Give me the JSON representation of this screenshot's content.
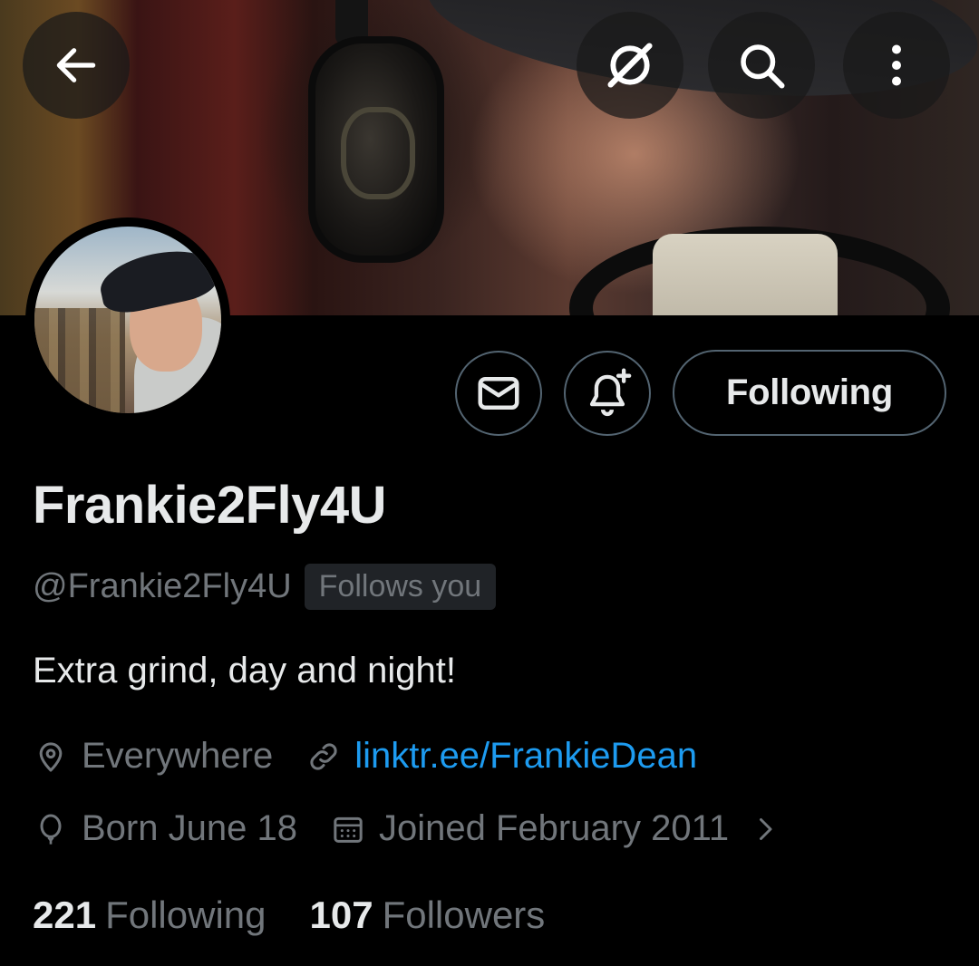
{
  "header": {
    "back_icon": "arrow-left-icon",
    "grok_icon": "grok-icon",
    "search_icon": "search-icon",
    "more_icon": "more-vertical-icon"
  },
  "profile": {
    "display_name": "Frankie2Fly4U",
    "handle": "@Frankie2Fly4U",
    "follows_you": "Follows you",
    "bio": "Extra grind, day and night!",
    "location": "Everywhere",
    "website": "linktr.ee/FrankieDean",
    "birthday": "Born June 18",
    "joined": "Joined February 2011"
  },
  "actions": {
    "message_icon": "envelope-icon",
    "notify_icon": "bell-plus-icon",
    "following_label": "Following"
  },
  "stats": {
    "following_count": "221",
    "following_label": "Following",
    "followers_count": "107",
    "followers_label": "Followers"
  },
  "colors": {
    "background": "#000000",
    "primary_text": "#e7e9ea",
    "secondary_text": "#71767b",
    "link": "#1d9bf0",
    "border": "#536471"
  }
}
